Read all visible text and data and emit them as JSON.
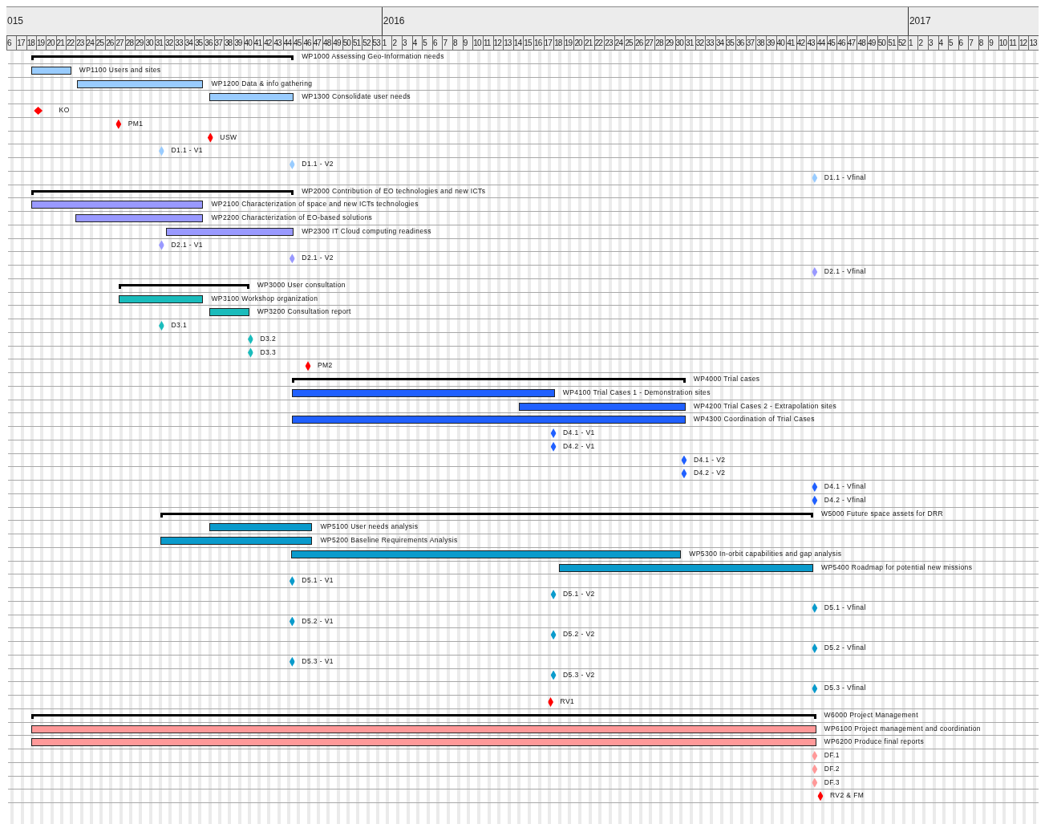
{
  "timeline": {
    "years": [
      {
        "label": "015",
        "weeks": [
          "6",
          "17",
          "18",
          "19",
          "20",
          "21",
          "22",
          "23",
          "24",
          "25",
          "26",
          "27",
          "28",
          "29",
          "30",
          "31",
          "32",
          "33",
          "34",
          "35",
          "36",
          "37",
          "38",
          "39",
          "40",
          "41",
          "42",
          "43",
          "44",
          "45",
          "46",
          "47",
          "48",
          "49",
          "50",
          "51",
          "52",
          "53"
        ]
      },
      {
        "label": "2016",
        "weeks": [
          "1",
          "2",
          "3",
          "4",
          "5",
          "6",
          "7",
          "8",
          "9",
          "10",
          "11",
          "12",
          "13",
          "14",
          "15",
          "16",
          "17",
          "18",
          "19",
          "20",
          "21",
          "22",
          "23",
          "24",
          "25",
          "26",
          "27",
          "28",
          "29",
          "30",
          "31",
          "32",
          "33",
          "34",
          "35",
          "36",
          "37",
          "38",
          "39",
          "40",
          "41",
          "42",
          "43",
          "44",
          "45",
          "46",
          "47",
          "48",
          "49",
          "50",
          "51",
          "52"
        ]
      },
      {
        "label": "2017",
        "weeks": [
          "1",
          "2",
          "3",
          "4",
          "5",
          "6",
          "7",
          "8",
          "9",
          "10",
          "11",
          "12",
          "13"
        ]
      }
    ]
  },
  "rows": [
    {
      "kind": "summary",
      "label": "WP1000 Assessing Geo-Information needs"
    },
    {
      "kind": "task",
      "label": "WP1100 Users and sites",
      "color": "#99ccff"
    },
    {
      "kind": "task",
      "label": "WP1200 Data & info gathering",
      "color": "#99ccff"
    },
    {
      "kind": "task",
      "label": "WP1300 Consolidate user needs",
      "color": "#99ccff"
    },
    {
      "kind": "milestone",
      "label": "KO",
      "color": "#ff0000"
    },
    {
      "kind": "milestone",
      "label": "PM1",
      "color": "#ff0000"
    },
    {
      "kind": "milestone",
      "label": "USW",
      "color": "#ff0000"
    },
    {
      "kind": "milestone",
      "label": "D1.1 - V1",
      "color": "#99ccff"
    },
    {
      "kind": "milestone",
      "label": "D1.1 - V2",
      "color": "#99ccff"
    },
    {
      "kind": "milestone",
      "label": "D1.1 - Vfinal",
      "color": "#99ccff"
    },
    {
      "kind": "summary",
      "label": "WP2000 Contribution of EO technologies and new ICTs"
    },
    {
      "kind": "task",
      "label": "WP2100 Characterization of space and new ICTs technologies",
      "color": "#9999ff"
    },
    {
      "kind": "task",
      "label": "WP2200 Characterization of EO-based solutions",
      "color": "#9999ff"
    },
    {
      "kind": "task",
      "label": "WP2300 IT Cloud computing readiness",
      "color": "#9999ff"
    },
    {
      "kind": "milestone",
      "label": "D2.1 - V1",
      "color": "#9999ff"
    },
    {
      "kind": "milestone",
      "label": "D2.1 - V2",
      "color": "#9999ff"
    },
    {
      "kind": "milestone",
      "label": "D2.1 - Vfinal",
      "color": "#9999ff"
    },
    {
      "kind": "summary",
      "label": "WP3000 User consultation"
    },
    {
      "kind": "task",
      "label": "WP3100 Workshop organization",
      "color": "#1abcbc"
    },
    {
      "kind": "task",
      "label": "WP3200 Consultation report",
      "color": "#1abcbc"
    },
    {
      "kind": "milestone",
      "label": "D3.1",
      "color": "#1abcbc"
    },
    {
      "kind": "milestone",
      "label": "D3.2",
      "color": "#1abcbc"
    },
    {
      "kind": "milestone",
      "label": "D3.3",
      "color": "#1abcbc"
    },
    {
      "kind": "milestone",
      "label": "PM2",
      "color": "#ff0000"
    },
    {
      "kind": "summary",
      "label": "WP4000 Trial cases"
    },
    {
      "kind": "task",
      "label": "WP4100 Trial Cases 1 - Demonstration sites",
      "color": "#2060ff"
    },
    {
      "kind": "task",
      "label": "WP4200 Trial Cases 2 -  Extrapolation sites",
      "color": "#2060ff"
    },
    {
      "kind": "task",
      "label": "WP4300 Coordination of Trial Cases",
      "color": "#2060ff"
    },
    {
      "kind": "milestone",
      "label": "D4.1 - V1",
      "color": "#2060ff"
    },
    {
      "kind": "milestone",
      "label": "D4.2 - V1",
      "color": "#2060ff"
    },
    {
      "kind": "milestone",
      "label": "D4.1 - V2",
      "color": "#2060ff"
    },
    {
      "kind": "milestone",
      "label": "D4.2 - V2",
      "color": "#2060ff"
    },
    {
      "kind": "milestone",
      "label": "D4.1 - Vfinal",
      "color": "#2060ff"
    },
    {
      "kind": "milestone",
      "label": "D4.2 - Vfinal",
      "color": "#2060ff"
    },
    {
      "kind": "summary",
      "label": "W5000 Future space assets for DRR"
    },
    {
      "kind": "task",
      "label": "WP5100 User needs analysis",
      "color": "#0a9bcc"
    },
    {
      "kind": "task",
      "label": "WP5200 Baseline Requirements Analysis",
      "color": "#0a9bcc"
    },
    {
      "kind": "task",
      "label": "WP5300 In-orbit capabilities and gap analysis",
      "color": "#0a9bcc"
    },
    {
      "kind": "task",
      "label": "WP5400 Roadmap for potential new missions",
      "color": "#0a9bcc"
    },
    {
      "kind": "milestone",
      "label": "D5.1 - V1",
      "color": "#0a9bcc"
    },
    {
      "kind": "milestone",
      "label": "D5.1 - V2",
      "color": "#0a9bcc"
    },
    {
      "kind": "milestone",
      "label": "D5.1 - Vfinal",
      "color": "#0a9bcc"
    },
    {
      "kind": "milestone",
      "label": "D5.2 - V1",
      "color": "#0a9bcc"
    },
    {
      "kind": "milestone",
      "label": "D5.2 - V2",
      "color": "#0a9bcc"
    },
    {
      "kind": "milestone",
      "label": "D5.2 - Vfinal",
      "color": "#0a9bcc"
    },
    {
      "kind": "milestone",
      "label": "D5.3 - V1",
      "color": "#0a9bcc"
    },
    {
      "kind": "milestone",
      "label": "D5.3 - V2",
      "color": "#0a9bcc"
    },
    {
      "kind": "milestone",
      "label": "D5.3 - Vfinal",
      "color": "#0a9bcc"
    },
    {
      "kind": "milestone",
      "label": "RV1",
      "color": "#ff0000"
    },
    {
      "kind": "summary",
      "label": "W6000 Project Management"
    },
    {
      "kind": "task",
      "label": "WP6100 Project management and coordination",
      "color": "#ff9999"
    },
    {
      "kind": "task",
      "label": "WP6200 Produce final reports",
      "color": "#ff9999"
    },
    {
      "kind": "milestone",
      "label": "DF.1",
      "color": "#ff9999"
    },
    {
      "kind": "milestone",
      "label": "DF.2",
      "color": "#ff9999"
    },
    {
      "kind": "milestone",
      "label": "DF.3",
      "color": "#ff9999"
    },
    {
      "kind": "milestone",
      "label": "RV2 & FM",
      "color": "#ff0000"
    }
  ]
}
